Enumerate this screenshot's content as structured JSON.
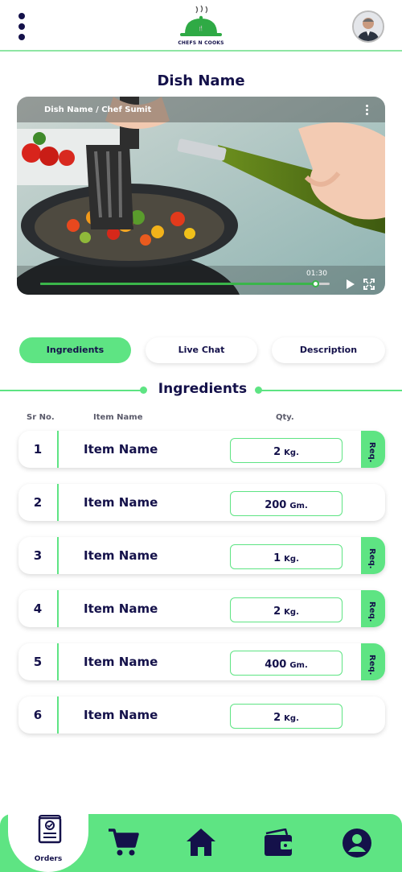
{
  "header": {
    "logo_text": "CHEFS N COOKS",
    "menu_icon": "kebab-menu-icon",
    "avatar_icon": "user-avatar"
  },
  "page_title": "Dish Name",
  "video": {
    "caption": "Dish Name / Chef Sumit",
    "time": "01:30",
    "progress": 0.95
  },
  "tabs": [
    {
      "label": "Ingredients",
      "active": true
    },
    {
      "label": "Live Chat",
      "active": false
    },
    {
      "label": "Description",
      "active": false
    }
  ],
  "section_title": "Ingredients",
  "columns": {
    "sr": "Sr No.",
    "name": "Item Name",
    "qty": "Qty."
  },
  "rows": [
    {
      "no": "1",
      "name": "Item Name",
      "qty": "2",
      "unit": "Kg.",
      "req": "Req."
    },
    {
      "no": "2",
      "name": "Item Name",
      "qty": "200",
      "unit": "Gm.",
      "req": ""
    },
    {
      "no": "3",
      "name": "Item Name",
      "qty": "1",
      "unit": "Kg.",
      "req": "Req."
    },
    {
      "no": "4",
      "name": "Item Name",
      "qty": "2",
      "unit": "Kg.",
      "req": "Req."
    },
    {
      "no": "5",
      "name": "Item Name",
      "qty": "400",
      "unit": "Gm.",
      "req": "Req."
    },
    {
      "no": "6",
      "name": "Item Name",
      "qty": "2",
      "unit": "Kg.",
      "req": ""
    }
  ],
  "bottom_nav": {
    "orders_label": "Orders",
    "icons": [
      "orders-icon",
      "cart-icon",
      "home-icon",
      "wallet-icon",
      "profile-icon"
    ]
  },
  "colors": {
    "accent": "#5ee483",
    "text": "#14114a",
    "slider": "#3ab54a"
  }
}
